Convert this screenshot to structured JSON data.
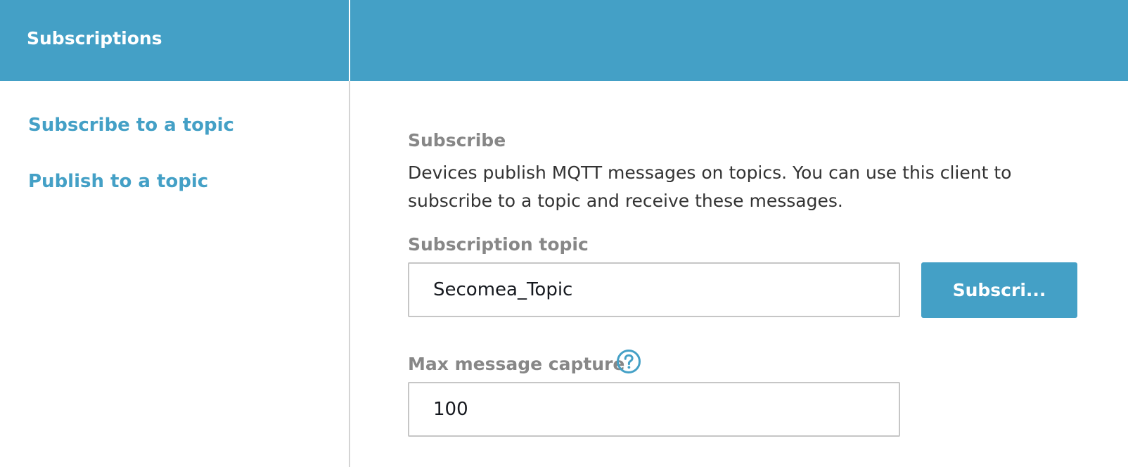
{
  "header": {
    "title": "Subscriptions"
  },
  "sidebar": {
    "items": [
      {
        "label": "Subscribe to a topic"
      },
      {
        "label": "Publish to a topic"
      }
    ]
  },
  "main": {
    "section_title": "Subscribe",
    "description": "Devices publish MQTT messages on topics. You can use this client to subscribe to a topic and receive these messages.",
    "topic_field": {
      "label": "Subscription topic",
      "value": "Secomea_Topic"
    },
    "subscribe_button": {
      "label": "Subscri..."
    },
    "max_capture_field": {
      "label": "Max message capture",
      "value": "100",
      "help_icon": "question-circle-icon"
    }
  },
  "colors": {
    "accent": "#44a0c6",
    "label_gray": "#878787",
    "text": "#333333",
    "input_border": "#c6c6c6"
  }
}
